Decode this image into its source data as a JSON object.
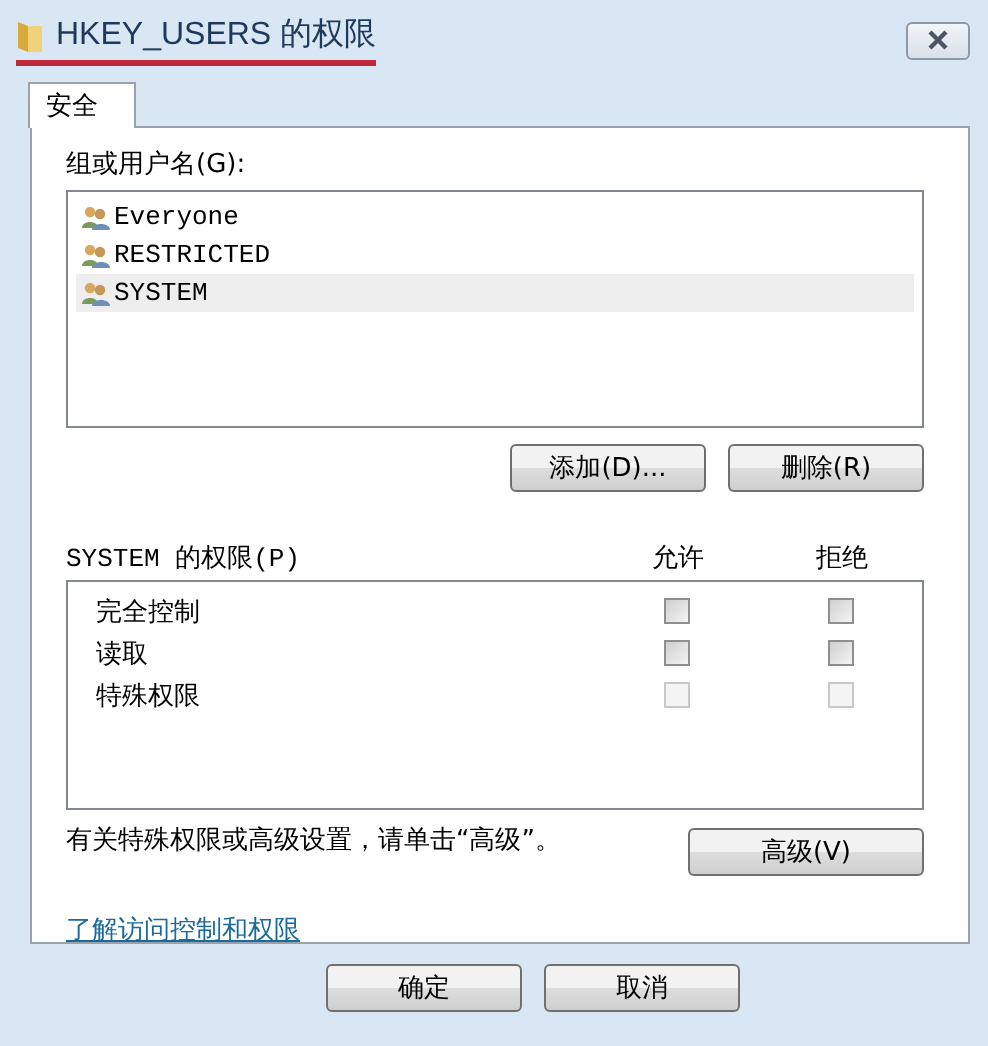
{
  "window": {
    "title": "HKEY_USERS 的权限",
    "title_underlined": true
  },
  "tabs": [
    {
      "label": "安全",
      "selected": true
    }
  ],
  "groups": {
    "label": "组或用户名(G):",
    "items": [
      {
        "name": "Everyone",
        "selected": false
      },
      {
        "name": "RESTRICTED",
        "selected": false
      },
      {
        "name": "SYSTEM",
        "selected": true
      }
    ],
    "buttons": [
      "添加(D)...",
      "删除(R)"
    ]
  },
  "permissions": {
    "label": "SYSTEM 的权限(P)",
    "allow_header": "允许",
    "deny_header": "拒绝",
    "rows": [
      {
        "name": "完全控制",
        "allow": false,
        "deny": false,
        "disabled": false
      },
      {
        "name": "读取",
        "allow": false,
        "deny": false,
        "disabled": false
      },
      {
        "name": "特殊权限",
        "allow": false,
        "deny": false,
        "disabled": true
      }
    ]
  },
  "advanced": {
    "text": "有关特殊权限或高级设置，请单击“高级”。",
    "button": "高级(V)"
  },
  "link": "了解访问控制和权限",
  "buttons": [
    "确定",
    "取消"
  ]
}
